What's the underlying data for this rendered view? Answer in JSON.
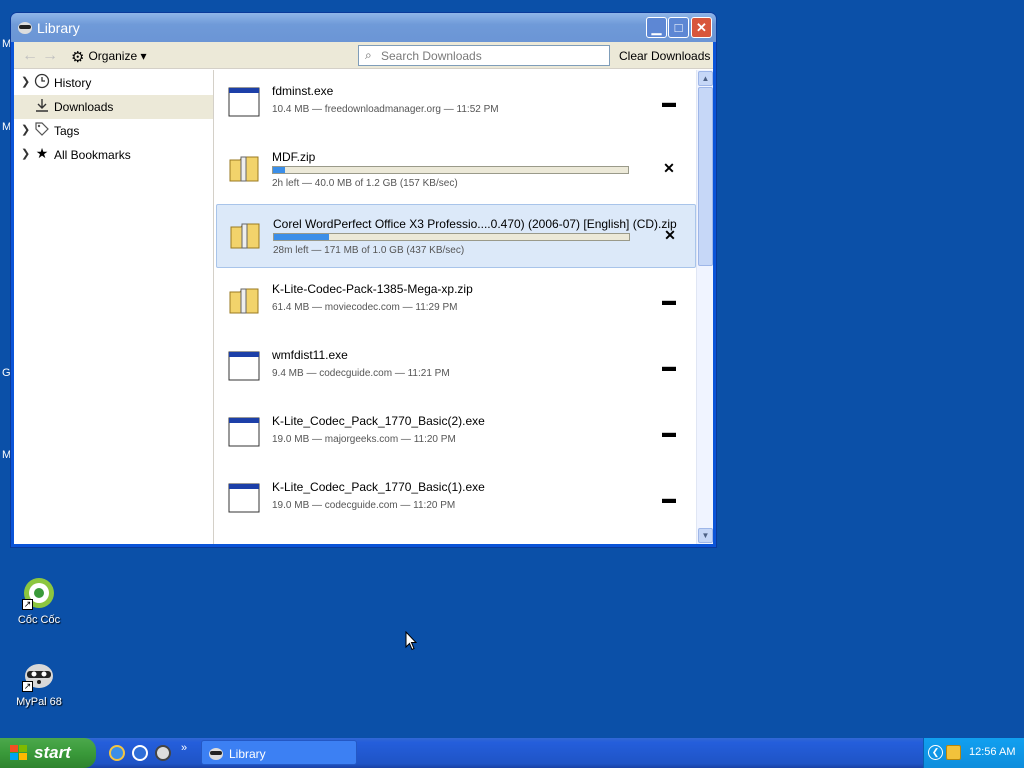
{
  "desktop": {
    "left_fragments": [
      "M",
      "M",
      "G",
      "M"
    ],
    "icons": [
      {
        "label": "Cốc Cốc"
      },
      {
        "label": "MyPal 68"
      }
    ]
  },
  "window": {
    "title": "Library",
    "toolbar": {
      "organize_label": "Organize",
      "search_placeholder": "Search Downloads",
      "clear_label": "Clear Downloads"
    },
    "sidebar": [
      {
        "label": "History",
        "icon": "clock-icon",
        "expandable": true,
        "active": false
      },
      {
        "label": "Downloads",
        "icon": "download-arrow-icon",
        "expandable": false,
        "active": true
      },
      {
        "label": "Tags",
        "icon": "tag-icon",
        "expandable": true,
        "active": false
      },
      {
        "label": "All Bookmarks",
        "icon": "star-icon",
        "expandable": true,
        "active": false
      }
    ],
    "downloads": [
      {
        "name": "fdminst.exe",
        "status": "10.4 MB — freedownloadmanager.org — 11:52 PM",
        "type": "exe",
        "state": "done",
        "progress": null
      },
      {
        "name": "MDF.zip",
        "status": "2h left — 40.0 MB of 1.2 GB (157 KB/sec)",
        "type": "zip",
        "state": "active",
        "progress": 0.034
      },
      {
        "name": "Corel WordPerfect Office X3 Professio....0.470) (2006-07) [English] (CD).zip",
        "status": "28m left — 171 MB of 1.0 GB (437 KB/sec)",
        "type": "zip",
        "state": "active",
        "progress": 0.155
      },
      {
        "name": "K-Lite-Codec-Pack-1385-Mega-xp.zip",
        "status": "61.4 MB — moviecodec.com — 11:29 PM",
        "type": "zip",
        "state": "done",
        "progress": null
      },
      {
        "name": "wmfdist11.exe",
        "status": "9.4 MB — codecguide.com — 11:21 PM",
        "type": "exe",
        "state": "done",
        "progress": null
      },
      {
        "name": "K-Lite_Codec_Pack_1770_Basic(2).exe",
        "status": "19.0 MB — majorgeeks.com — 11:20 PM",
        "type": "exe",
        "state": "done",
        "progress": null
      },
      {
        "name": "K-Lite_Codec_Pack_1770_Basic(1).exe",
        "status": "19.0 MB — codecguide.com — 11:20 PM",
        "type": "exe",
        "state": "done",
        "progress": null
      }
    ]
  },
  "taskbar": {
    "start_label": "start",
    "task_label": "Library",
    "clock": "12:56 AM"
  }
}
